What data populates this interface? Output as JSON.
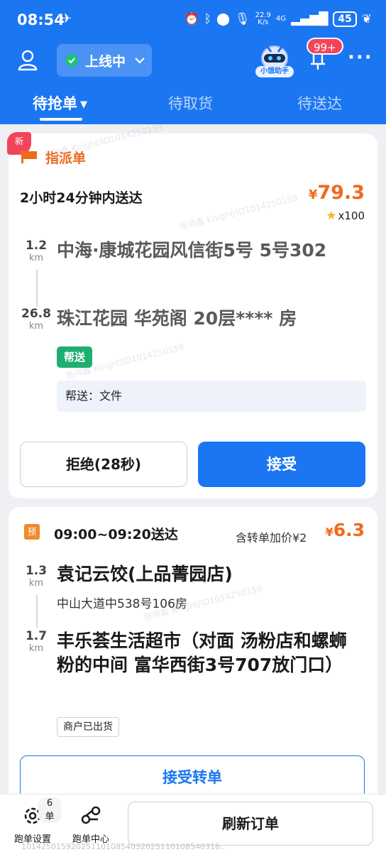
{
  "status_bar": {
    "time": "08:54",
    "network_speed": "22.9",
    "network_speed_unit": "K/s",
    "network_type": "4G",
    "battery": "45"
  },
  "header": {
    "online_status": "上线中",
    "assistant_label": "小饿助手",
    "notification_badge": "99+",
    "more": "···"
  },
  "tabs": [
    {
      "label": "待抢单",
      "active": true
    },
    {
      "label": "待取货",
      "active": false
    },
    {
      "label": "待送达",
      "active": false
    }
  ],
  "order1": {
    "new_tag": "新",
    "type_label": "指派单",
    "deliver_time": "2小时24分钟内送达",
    "currency": "¥",
    "price": "79.3",
    "star_count": "x100",
    "pickup": {
      "distance": "1.2",
      "unit": "km",
      "address": "中海·康城花园风信街5号 5号302"
    },
    "dropoff": {
      "distance": "26.8",
      "unit": "km",
      "address": "珠江花园 华苑阁 20层**** 房"
    },
    "service_tag": "帮送",
    "note": "帮送：文件",
    "reject_label": "拒绝(28秒)",
    "accept_label": "接受"
  },
  "order2": {
    "pre_tag": "预",
    "time_window": "09:00~09:20送达",
    "transfer_extra": "含转单加价¥2",
    "currency": "¥",
    "price": "6.3",
    "pickup": {
      "distance": "1.3",
      "unit": "km",
      "name": "袁记云饺(上品菁园店)",
      "address": "中山大道中538号106房"
    },
    "dropoff": {
      "distance": "1.7",
      "unit": "km",
      "address": "丰乐荟生活超市（对面 汤粉店和螺蛳粉的中间 富华西街3号707放门口）"
    },
    "status_tag": "商户已出货",
    "transfer_label": "接受转单"
  },
  "bottom_bar": {
    "settings_label": "跑单设置",
    "order_count": "6单",
    "center_label": "跑单中心",
    "refresh_label": "刷新订单"
  },
  "footer_id": "1014250159202511010854032025110108540316..",
  "watermark": "张鸿鑫 Knight/ID1014250159",
  "colors": {
    "primary": "#1b76f2",
    "price": "#f06a1b",
    "online": "#1ec27a",
    "badge": "#f2455b"
  }
}
